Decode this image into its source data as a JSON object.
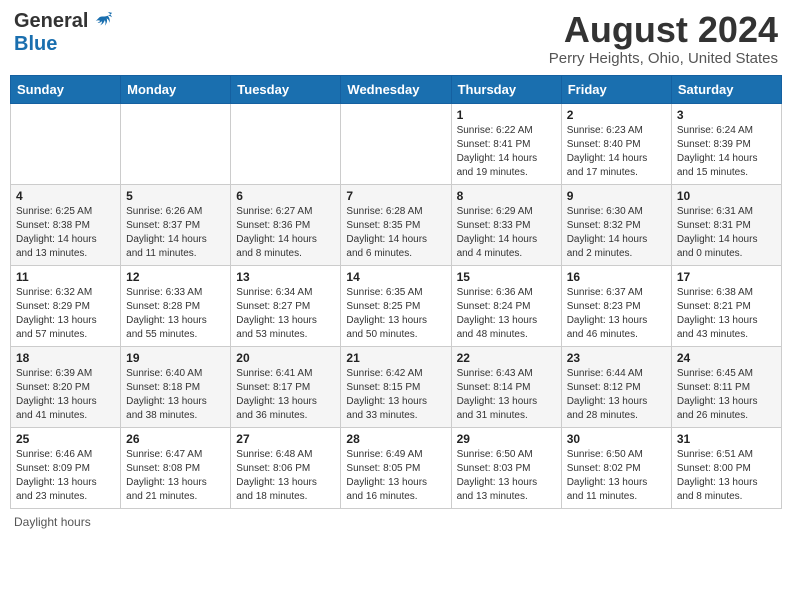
{
  "header": {
    "logo_general": "General",
    "logo_blue": "Blue",
    "month_title": "August 2024",
    "location": "Perry Heights, Ohio, United States"
  },
  "days_of_week": [
    "Sunday",
    "Monday",
    "Tuesday",
    "Wednesday",
    "Thursday",
    "Friday",
    "Saturday"
  ],
  "weeks": [
    [
      {
        "day": "",
        "info": ""
      },
      {
        "day": "",
        "info": ""
      },
      {
        "day": "",
        "info": ""
      },
      {
        "day": "",
        "info": ""
      },
      {
        "day": "1",
        "info": "Sunrise: 6:22 AM\nSunset: 8:41 PM\nDaylight: 14 hours\nand 19 minutes."
      },
      {
        "day": "2",
        "info": "Sunrise: 6:23 AM\nSunset: 8:40 PM\nDaylight: 14 hours\nand 17 minutes."
      },
      {
        "day": "3",
        "info": "Sunrise: 6:24 AM\nSunset: 8:39 PM\nDaylight: 14 hours\nand 15 minutes."
      }
    ],
    [
      {
        "day": "4",
        "info": "Sunrise: 6:25 AM\nSunset: 8:38 PM\nDaylight: 14 hours\nand 13 minutes."
      },
      {
        "day": "5",
        "info": "Sunrise: 6:26 AM\nSunset: 8:37 PM\nDaylight: 14 hours\nand 11 minutes."
      },
      {
        "day": "6",
        "info": "Sunrise: 6:27 AM\nSunset: 8:36 PM\nDaylight: 14 hours\nand 8 minutes."
      },
      {
        "day": "7",
        "info": "Sunrise: 6:28 AM\nSunset: 8:35 PM\nDaylight: 14 hours\nand 6 minutes."
      },
      {
        "day": "8",
        "info": "Sunrise: 6:29 AM\nSunset: 8:33 PM\nDaylight: 14 hours\nand 4 minutes."
      },
      {
        "day": "9",
        "info": "Sunrise: 6:30 AM\nSunset: 8:32 PM\nDaylight: 14 hours\nand 2 minutes."
      },
      {
        "day": "10",
        "info": "Sunrise: 6:31 AM\nSunset: 8:31 PM\nDaylight: 14 hours\nand 0 minutes."
      }
    ],
    [
      {
        "day": "11",
        "info": "Sunrise: 6:32 AM\nSunset: 8:29 PM\nDaylight: 13 hours\nand 57 minutes."
      },
      {
        "day": "12",
        "info": "Sunrise: 6:33 AM\nSunset: 8:28 PM\nDaylight: 13 hours\nand 55 minutes."
      },
      {
        "day": "13",
        "info": "Sunrise: 6:34 AM\nSunset: 8:27 PM\nDaylight: 13 hours\nand 53 minutes."
      },
      {
        "day": "14",
        "info": "Sunrise: 6:35 AM\nSunset: 8:25 PM\nDaylight: 13 hours\nand 50 minutes."
      },
      {
        "day": "15",
        "info": "Sunrise: 6:36 AM\nSunset: 8:24 PM\nDaylight: 13 hours\nand 48 minutes."
      },
      {
        "day": "16",
        "info": "Sunrise: 6:37 AM\nSunset: 8:23 PM\nDaylight: 13 hours\nand 46 minutes."
      },
      {
        "day": "17",
        "info": "Sunrise: 6:38 AM\nSunset: 8:21 PM\nDaylight: 13 hours\nand 43 minutes."
      }
    ],
    [
      {
        "day": "18",
        "info": "Sunrise: 6:39 AM\nSunset: 8:20 PM\nDaylight: 13 hours\nand 41 minutes."
      },
      {
        "day": "19",
        "info": "Sunrise: 6:40 AM\nSunset: 8:18 PM\nDaylight: 13 hours\nand 38 minutes."
      },
      {
        "day": "20",
        "info": "Sunrise: 6:41 AM\nSunset: 8:17 PM\nDaylight: 13 hours\nand 36 minutes."
      },
      {
        "day": "21",
        "info": "Sunrise: 6:42 AM\nSunset: 8:15 PM\nDaylight: 13 hours\nand 33 minutes."
      },
      {
        "day": "22",
        "info": "Sunrise: 6:43 AM\nSunset: 8:14 PM\nDaylight: 13 hours\nand 31 minutes."
      },
      {
        "day": "23",
        "info": "Sunrise: 6:44 AM\nSunset: 8:12 PM\nDaylight: 13 hours\nand 28 minutes."
      },
      {
        "day": "24",
        "info": "Sunrise: 6:45 AM\nSunset: 8:11 PM\nDaylight: 13 hours\nand 26 minutes."
      }
    ],
    [
      {
        "day": "25",
        "info": "Sunrise: 6:46 AM\nSunset: 8:09 PM\nDaylight: 13 hours\nand 23 minutes."
      },
      {
        "day": "26",
        "info": "Sunrise: 6:47 AM\nSunset: 8:08 PM\nDaylight: 13 hours\nand 21 minutes."
      },
      {
        "day": "27",
        "info": "Sunrise: 6:48 AM\nSunset: 8:06 PM\nDaylight: 13 hours\nand 18 minutes."
      },
      {
        "day": "28",
        "info": "Sunrise: 6:49 AM\nSunset: 8:05 PM\nDaylight: 13 hours\nand 16 minutes."
      },
      {
        "day": "29",
        "info": "Sunrise: 6:50 AM\nSunset: 8:03 PM\nDaylight: 13 hours\nand 13 minutes."
      },
      {
        "day": "30",
        "info": "Sunrise: 6:50 AM\nSunset: 8:02 PM\nDaylight: 13 hours\nand 11 minutes."
      },
      {
        "day": "31",
        "info": "Sunrise: 6:51 AM\nSunset: 8:00 PM\nDaylight: 13 hours\nand 8 minutes."
      }
    ]
  ],
  "footer": {
    "daylight_label": "Daylight hours"
  }
}
